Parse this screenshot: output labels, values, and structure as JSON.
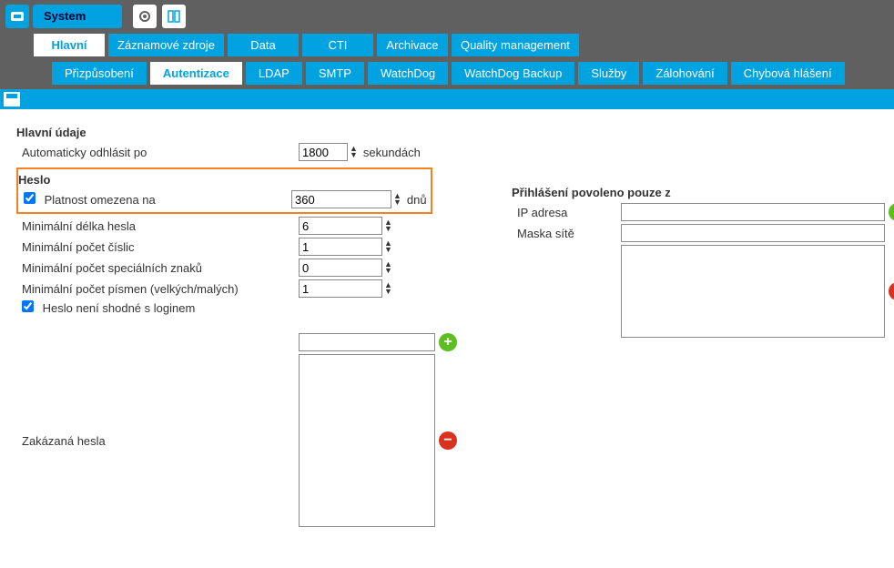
{
  "topbar": {
    "title": "System"
  },
  "tabs": [
    "Hlavní",
    "Záznamové zdroje",
    "Data",
    "CTI",
    "Archivace",
    "Quality management"
  ],
  "tabs_active": 0,
  "subtabs": [
    "Přizpůsobení",
    "Autentizace",
    "LDAP",
    "SMTP",
    "WatchDog",
    "WatchDog Backup",
    "Služby",
    "Zálohování",
    "Chybová hlášení"
  ],
  "subtabs_active": 1,
  "main": {
    "section_main_title": "Hlavní údaje",
    "auto_logout_label": "Automaticky odhlásit po",
    "auto_logout_value": "1800",
    "auto_logout_unit": "sekundách",
    "section_pwd_title": "Heslo",
    "validity_label": "Platnost omezena na",
    "validity_checked": true,
    "validity_value": "360",
    "validity_unit": "dnů",
    "min_len_label": "Minimální délka hesla",
    "min_len_value": "6",
    "min_digits_label": "Minimální počet číslic",
    "min_digits_value": "1",
    "min_special_label": "Minimální počet speciálních znaků",
    "min_special_value": "0",
    "min_letters_label": "Minimální počet písmen (velkých/malých)",
    "min_letters_value": "1",
    "not_login_label": "Heslo není shodné s loginem",
    "not_login_checked": true,
    "forbidden_label": "Zakázaná hesla",
    "forbidden_new_value": ""
  },
  "login_from": {
    "section_title": "Přihlášení povoleno pouze z",
    "ip_label": "IP adresa",
    "ip_value": "",
    "mask_label": "Maska sítě",
    "mask_value": ""
  }
}
